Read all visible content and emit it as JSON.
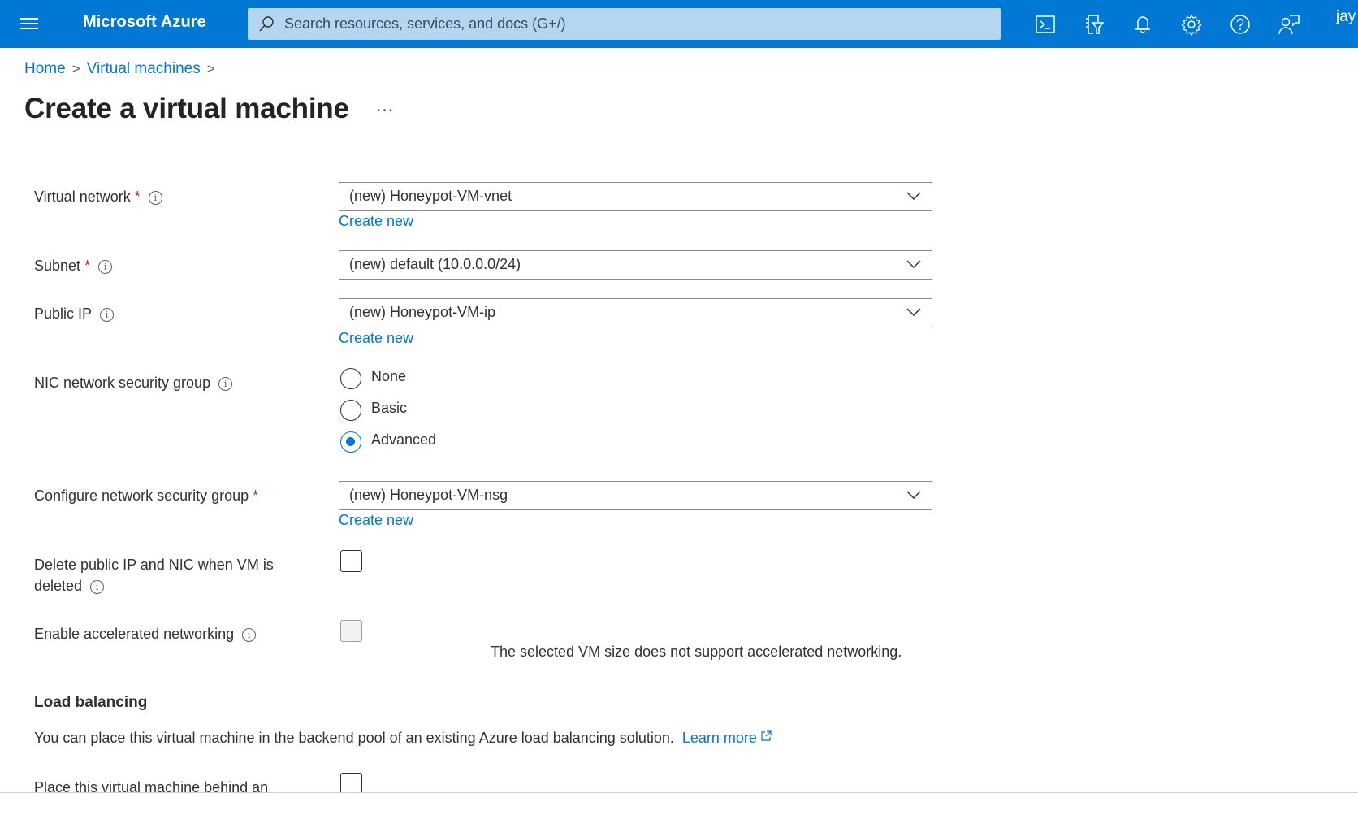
{
  "header": {
    "brand": "Microsoft Azure",
    "search_placeholder": "Search resources, services, and docs (G+/)",
    "user": "jay",
    "icons": [
      "cloud-shell-icon",
      "directory-filter-icon",
      "notifications-bell-icon",
      "settings-gear-icon",
      "help-question-icon",
      "feedback-icon"
    ]
  },
  "breadcrumb": {
    "items": [
      "Home",
      "Virtual machines"
    ],
    "separator": ">"
  },
  "page": {
    "title": "Create a virtual machine",
    "more_label": "···"
  },
  "form": {
    "virtual_network": {
      "label": "Virtual network",
      "required_mark": "*",
      "value": "(new) Honeypot-VM-vnet",
      "create_new": "Create new"
    },
    "subnet": {
      "label": "Subnet",
      "required_mark": "*",
      "value": "(new) default (10.0.0.0/24)"
    },
    "public_ip": {
      "label": "Public IP",
      "value": "(new) Honeypot-VM-ip",
      "create_new": "Create new"
    },
    "nic_nsg": {
      "label": "NIC network security group",
      "options": [
        "None",
        "Basic",
        "Advanced"
      ],
      "selected": "Advanced"
    },
    "configure_nsg": {
      "label": "Configure network security group",
      "required_mark": "*",
      "value": "(new) Honeypot-VM-nsg",
      "create_new": "Create new"
    },
    "delete_public_ip": {
      "label_line1": "Delete public IP and NIC when VM is",
      "label_line2": "deleted",
      "checked": false
    },
    "accelerated_networking": {
      "label": "Enable accelerated networking",
      "checked": false,
      "disabled": true,
      "note": "The selected VM size does not support accelerated networking."
    }
  },
  "load_balancing": {
    "heading": "Load balancing",
    "description": "You can place this virtual machine in the backend pool of an existing Azure load balancing solution.",
    "learn_more": "Learn more",
    "place_behind_label": "Place this virtual machine behind an",
    "place_behind_checked": false
  },
  "info_glyph": "i"
}
